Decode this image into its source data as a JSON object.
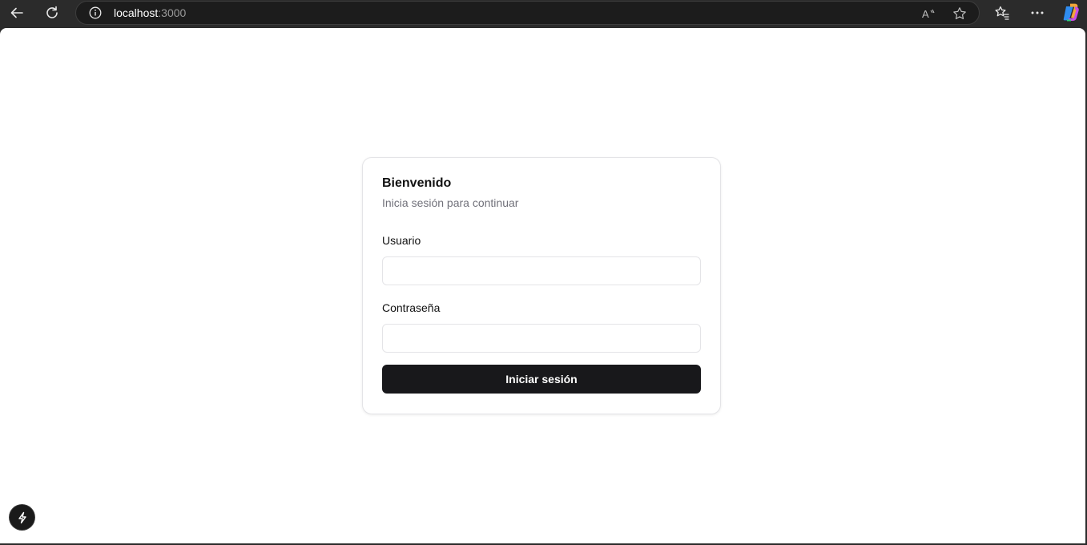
{
  "browser": {
    "url_host": "localhost",
    "url_port": ":3000"
  },
  "login": {
    "title": "Bienvenido",
    "subtitle": "Inicia sesión para continuar",
    "username_label": "Usuario",
    "username_value": "",
    "password_label": "Contraseña",
    "password_value": "",
    "submit_label": "Iniciar sesión"
  },
  "icons": {
    "back": "back-arrow-icon",
    "refresh": "refresh-icon",
    "info": "info-icon",
    "read_aloud": "read-aloud-icon",
    "favorite": "star-icon",
    "favorites": "favorites-icon",
    "more": "more-icon",
    "copilot": "copilot-icon",
    "dev_indicator": "lightning-icon"
  },
  "colors": {
    "button_bg": "#18181b",
    "subtitle_text": "#71717a",
    "border": "#e4e4e7"
  }
}
